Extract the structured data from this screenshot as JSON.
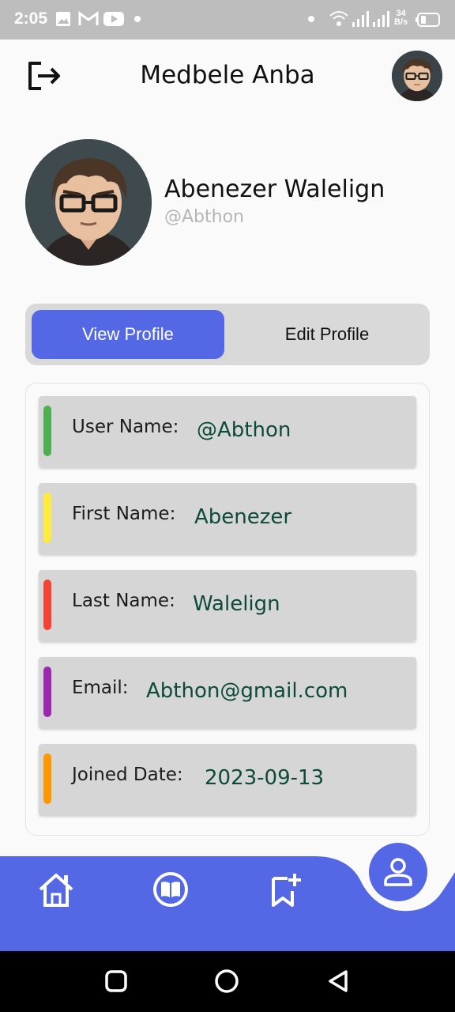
{
  "status_bar": {
    "time": "2:05",
    "net_speed_top": "34",
    "net_speed_bottom": "B/s"
  },
  "header": {
    "title": "Medbele Anba"
  },
  "profile": {
    "full_name": "Abenezer Walelign",
    "handle": "@Abthon"
  },
  "toggle": {
    "view_label": "View Profile",
    "edit_label": "Edit Profile",
    "active": "view"
  },
  "details": [
    {
      "label": "User Name:",
      "value": "@Abthon",
      "accent": "#4caf50"
    },
    {
      "label": "First Name:",
      "value": "Abenezer",
      "accent": "#ffeb3b"
    },
    {
      "label": "Last Name:",
      "value": "Walelign",
      "accent": "#f44336"
    },
    {
      "label": "Email:",
      "value": "Abthon@gmail.com",
      "accent": "#9c27b0"
    },
    {
      "label": "Joined Date:",
      "value": "2023-09-13",
      "accent": "#ff9800"
    }
  ],
  "nav": {
    "items": [
      "home-icon",
      "book-icon",
      "bookmark-add-icon",
      "person-icon"
    ],
    "active": "person-icon"
  },
  "colors": {
    "primary": "#5468e5",
    "value_text": "#0d4a3a",
    "status_bar": "#bdbdbd"
  }
}
